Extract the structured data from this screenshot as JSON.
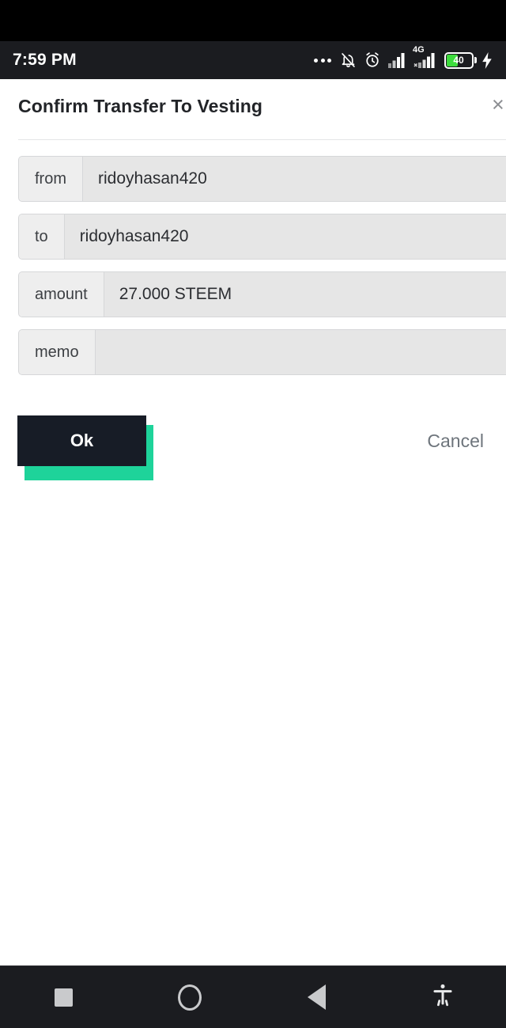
{
  "status_bar": {
    "time": "7:59 PM",
    "icons": [
      {
        "name": "more-dots-icon",
        "label": "..."
      },
      {
        "name": "bell-muted-icon",
        "label": "notifications silenced"
      },
      {
        "name": "alarm-clock-icon",
        "label": "alarm set"
      },
      {
        "name": "signal-bars-icon",
        "label": "signal"
      },
      {
        "name": "signal-4g-icon",
        "label": "4G"
      },
      {
        "name": "battery-icon",
        "label": "battery"
      },
      {
        "name": "charging-bolt-icon",
        "label": "charging"
      }
    ],
    "network_type": "4G",
    "battery_level": "40",
    "battery_fill_color": "#3ddc3d"
  },
  "dialog": {
    "title": "Confirm Transfer To Vesting",
    "close_label": "×",
    "rows": [
      {
        "label": "from",
        "value": "ridoyhasan420"
      },
      {
        "label": "to",
        "value": "ridoyhasan420"
      },
      {
        "label": "amount",
        "value": "27.000 STEEM"
      },
      {
        "label": "memo",
        "value": ""
      }
    ],
    "confirm_label": "Ok",
    "cancel_label": "Cancel",
    "accent_color": "#1ed39a",
    "confirm_bg_color": "#171c26"
  },
  "nav_bar": {
    "recents_label": "Recent apps",
    "home_label": "Home",
    "back_label": "Back",
    "accessibility_label": "Accessibility"
  }
}
